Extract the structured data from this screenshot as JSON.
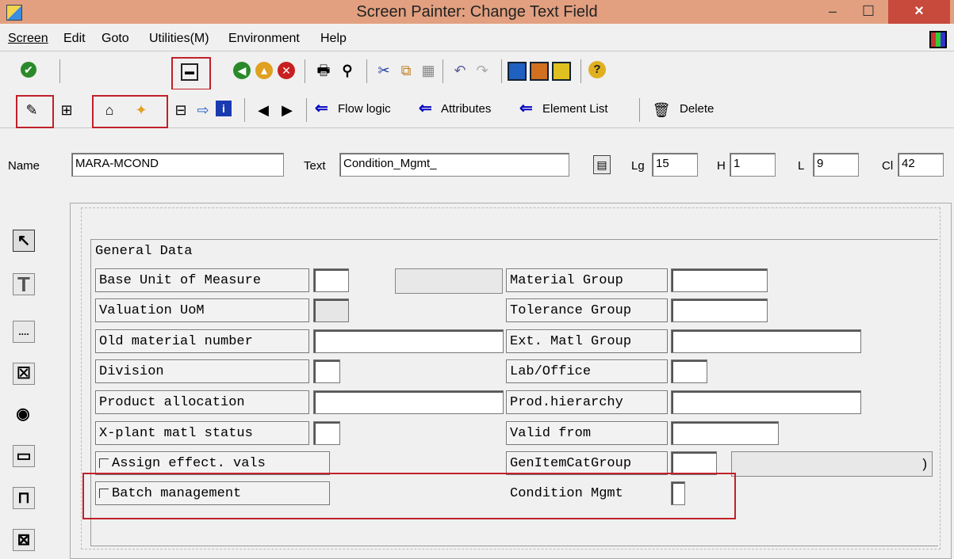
{
  "window": {
    "title": "Screen Painter:  Change Text Field",
    "minimize": "–",
    "maximize": "☐",
    "close": "×"
  },
  "menubar": {
    "items": [
      "Screen",
      "Edit",
      "Goto",
      "Utilities(M)",
      "Environment",
      "Help"
    ]
  },
  "toolbar2": {
    "flow_logic": "Flow logic",
    "attributes": "Attributes",
    "element_list": "Element List",
    "delete": "Delete"
  },
  "attributes_row": {
    "name_label": "Name",
    "name_value": "MARA-MCOND",
    "text_label": "Text",
    "text_value": "Condition_Mgmt_",
    "lg_label": "Lg",
    "lg_value": "15",
    "h_label": "H",
    "h_value": "1",
    "l_label": "L",
    "l_value": "9",
    "cl_label": "Cl",
    "cl_value": "42"
  },
  "layout": {
    "frame_title": "General Data",
    "left_labels": [
      "Base Unit of Measure",
      "Valuation UoM",
      "Old material number",
      "Division",
      "Product allocation",
      "X-plant matl status"
    ],
    "checkbox_labels": [
      "Assign effect. vals",
      "Batch management"
    ],
    "right_labels": [
      "Material Group",
      "Tolerance Group",
      "Ext. Matl Group",
      "Lab/Office",
      "Prod.hierarchy",
      "Valid from",
      "GenItemCatGroup",
      "Condition Mgmt"
    ],
    "bracket_text": ")"
  },
  "colors": {
    "highlight": "#c0202a",
    "titlebar": "#e2a080",
    "close": "#c84a3c"
  }
}
